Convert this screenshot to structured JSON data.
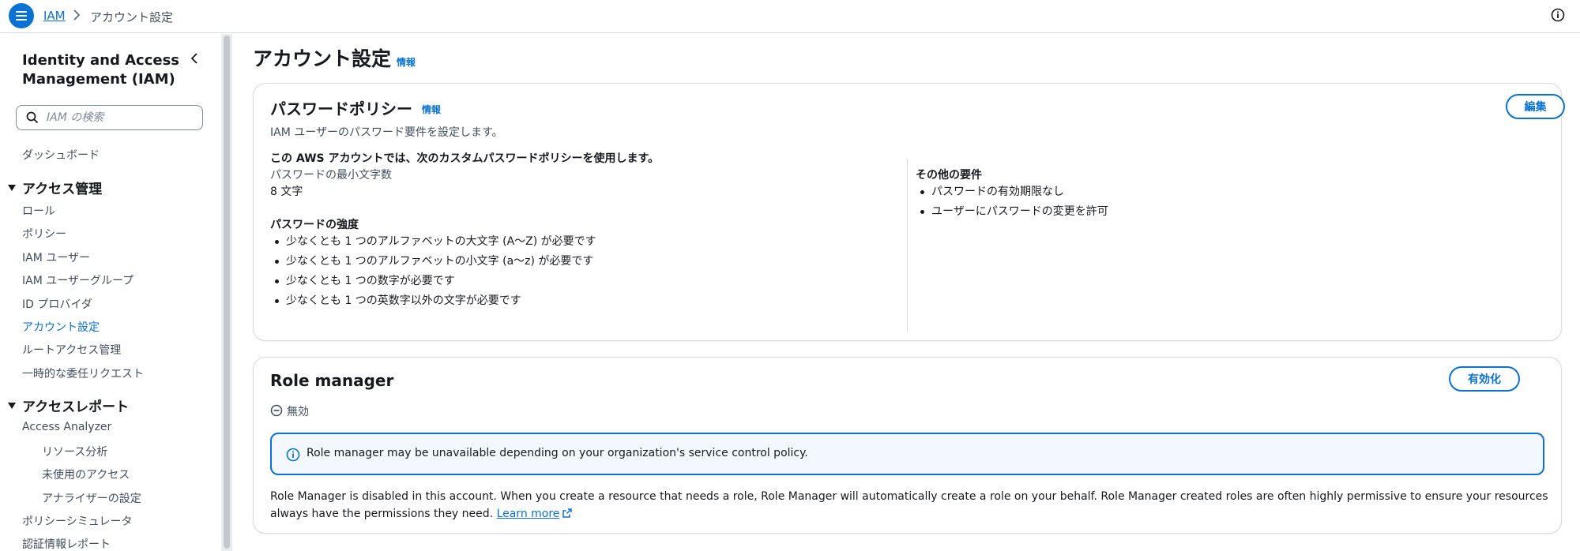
{
  "topbar": {
    "breadcrumb_root": "IAM",
    "breadcrumb_current": "アカウント設定"
  },
  "sidebar": {
    "title": "Identity and Access Management (IAM)",
    "search_placeholder": "IAM の検索",
    "dashboard": "ダッシュボード",
    "section_access_management": "アクセス管理",
    "access_items": [
      "ロール",
      "ポリシー",
      "IAM ユーザー",
      "IAM ユーザーグループ",
      "ID プロバイダ",
      "アカウント設定",
      "ルートアクセス管理",
      "一時的な委任リクエスト"
    ],
    "section_access_reports": "アクセスレポート",
    "report_items": [
      "Access Analyzer",
      "リソース分析",
      "未使用のアクセス",
      "アナライザーの設定",
      "ポリシーシミュレータ",
      "認証情報レポート"
    ]
  },
  "main": {
    "page_title": "アカウント設定",
    "info_label": "情報",
    "password_policy": {
      "title": "パスワードポリシー",
      "info_label": "情報",
      "edit_button": "編集",
      "subtitle": "IAM ユーザーのパスワード要件を設定します。",
      "policy_statement": "この AWS アカウントでは、次のカスタムパスワードポリシーを使用します。",
      "min_length_label": "パスワードの最小文字数",
      "min_length_value": "8 文字",
      "strength_heading": "パスワードの強度",
      "strength_items": [
        "少なくとも 1 つのアルファベットの大文字 (A〜Z) が必要です",
        "少なくとも 1 つのアルファベットの小文字 (a〜z) が必要です",
        "少なくとも 1 つの数字が必要です",
        "少なくとも 1 つの英数字以外の文字が必要です"
      ],
      "other_heading": "その他の要件",
      "other_items": [
        "パスワードの有効期限なし",
        "ユーザーにパスワードの変更を許可"
      ]
    },
    "role_manager": {
      "title": "Role manager",
      "enable_button": "有効化",
      "status": "無効",
      "alert": "Role manager may be unavailable depending on your organization's service control policy.",
      "description": "Role Manager is disabled in this account. When you create a resource that needs a role, Role Manager will automatically create a role on your behalf. Role Manager created roles are often highly permissive to ensure your resources always have the permissions they need.",
      "learn_more": "Learn more"
    }
  },
  "colors": {
    "accent": "#0972d3",
    "alert_bg": "#f2f8fd",
    "border": "#d5dbdb"
  }
}
